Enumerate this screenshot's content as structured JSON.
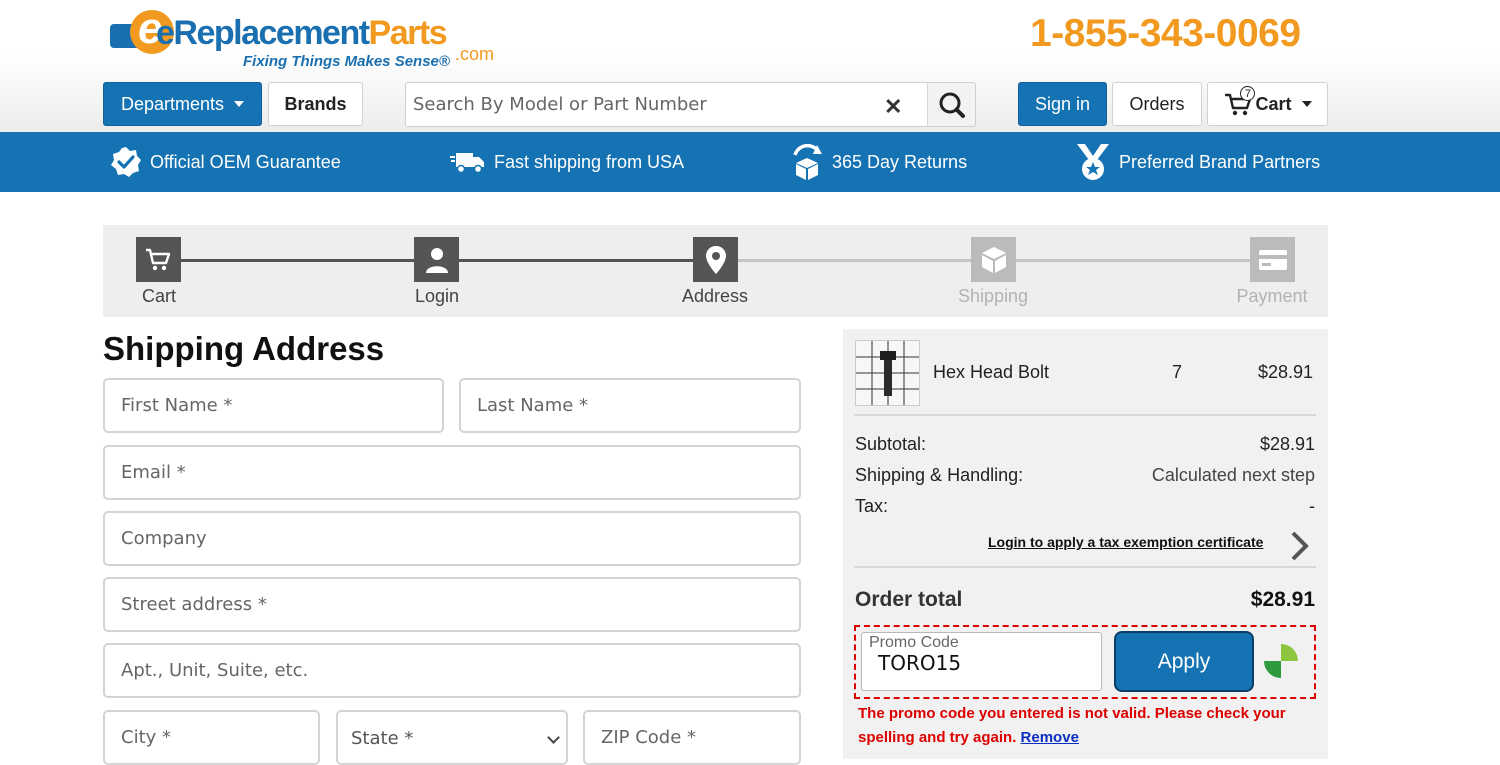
{
  "header": {
    "logo_brand_main": "eReplacement",
    "logo_brand_accent": "Parts",
    "logo_suffix": ".com",
    "logo_tagline": "Fixing Things Makes Sense®",
    "phone": "1-855-343-0069",
    "departments_label": "Departments",
    "brands_label": "Brands",
    "search_placeholder": "Search By Model or Part Number",
    "search_clear": "✕",
    "signin_label": "Sign in",
    "orders_label": "Orders",
    "cart_label": "Cart",
    "cart_count": "7"
  },
  "band": [
    {
      "label": "Official OEM Guarantee",
      "icon": "check-badge-icon"
    },
    {
      "label": "Fast shipping from USA",
      "icon": "truck-icon"
    },
    {
      "label": "365 Day Returns",
      "icon": "returns-box-icon"
    },
    {
      "label": "Preferred Brand Partners",
      "icon": "medal-icon"
    }
  ],
  "steps": [
    {
      "label": "Cart",
      "state": "done"
    },
    {
      "label": "Login",
      "state": "done"
    },
    {
      "label": "Address",
      "state": "current"
    },
    {
      "label": "Shipping",
      "state": "pending"
    },
    {
      "label": "Payment",
      "state": "pending"
    }
  ],
  "form": {
    "title": "Shipping Address",
    "first_name": "First Name *",
    "last_name": "Last Name *",
    "email": "Email *",
    "company": "Company",
    "street": "Street address *",
    "apt": "Apt., Unit, Suite, etc.",
    "city": "City *",
    "state": "State *",
    "zip": "ZIP Code *"
  },
  "summary": {
    "item_name": "Hex Head Bolt",
    "item_qty": "7",
    "item_price": "$28.91",
    "subtotal_label": "Subtotal:",
    "subtotal_value": "$28.91",
    "shipping_label": "Shipping & Handling:",
    "shipping_value": "Calculated next step",
    "tax_label": "Tax:",
    "tax_value": "-",
    "tax_link": "Login to apply a tax exemption certificate",
    "total_label": "Order total",
    "total_value": "$28.91",
    "promo_label": "Promo Code",
    "promo_value": "TORO15",
    "apply_label": "Apply",
    "error_text": "The promo code you entered is not valid. Please check your spelling and try again.",
    "remove_label": "Remove"
  },
  "colors": {
    "brand_blue": "#1573b3",
    "brand_orange": "#f29a1f",
    "error_red": "#dd0000",
    "step_done": "#555555",
    "step_pending": "#bbbbbb"
  }
}
